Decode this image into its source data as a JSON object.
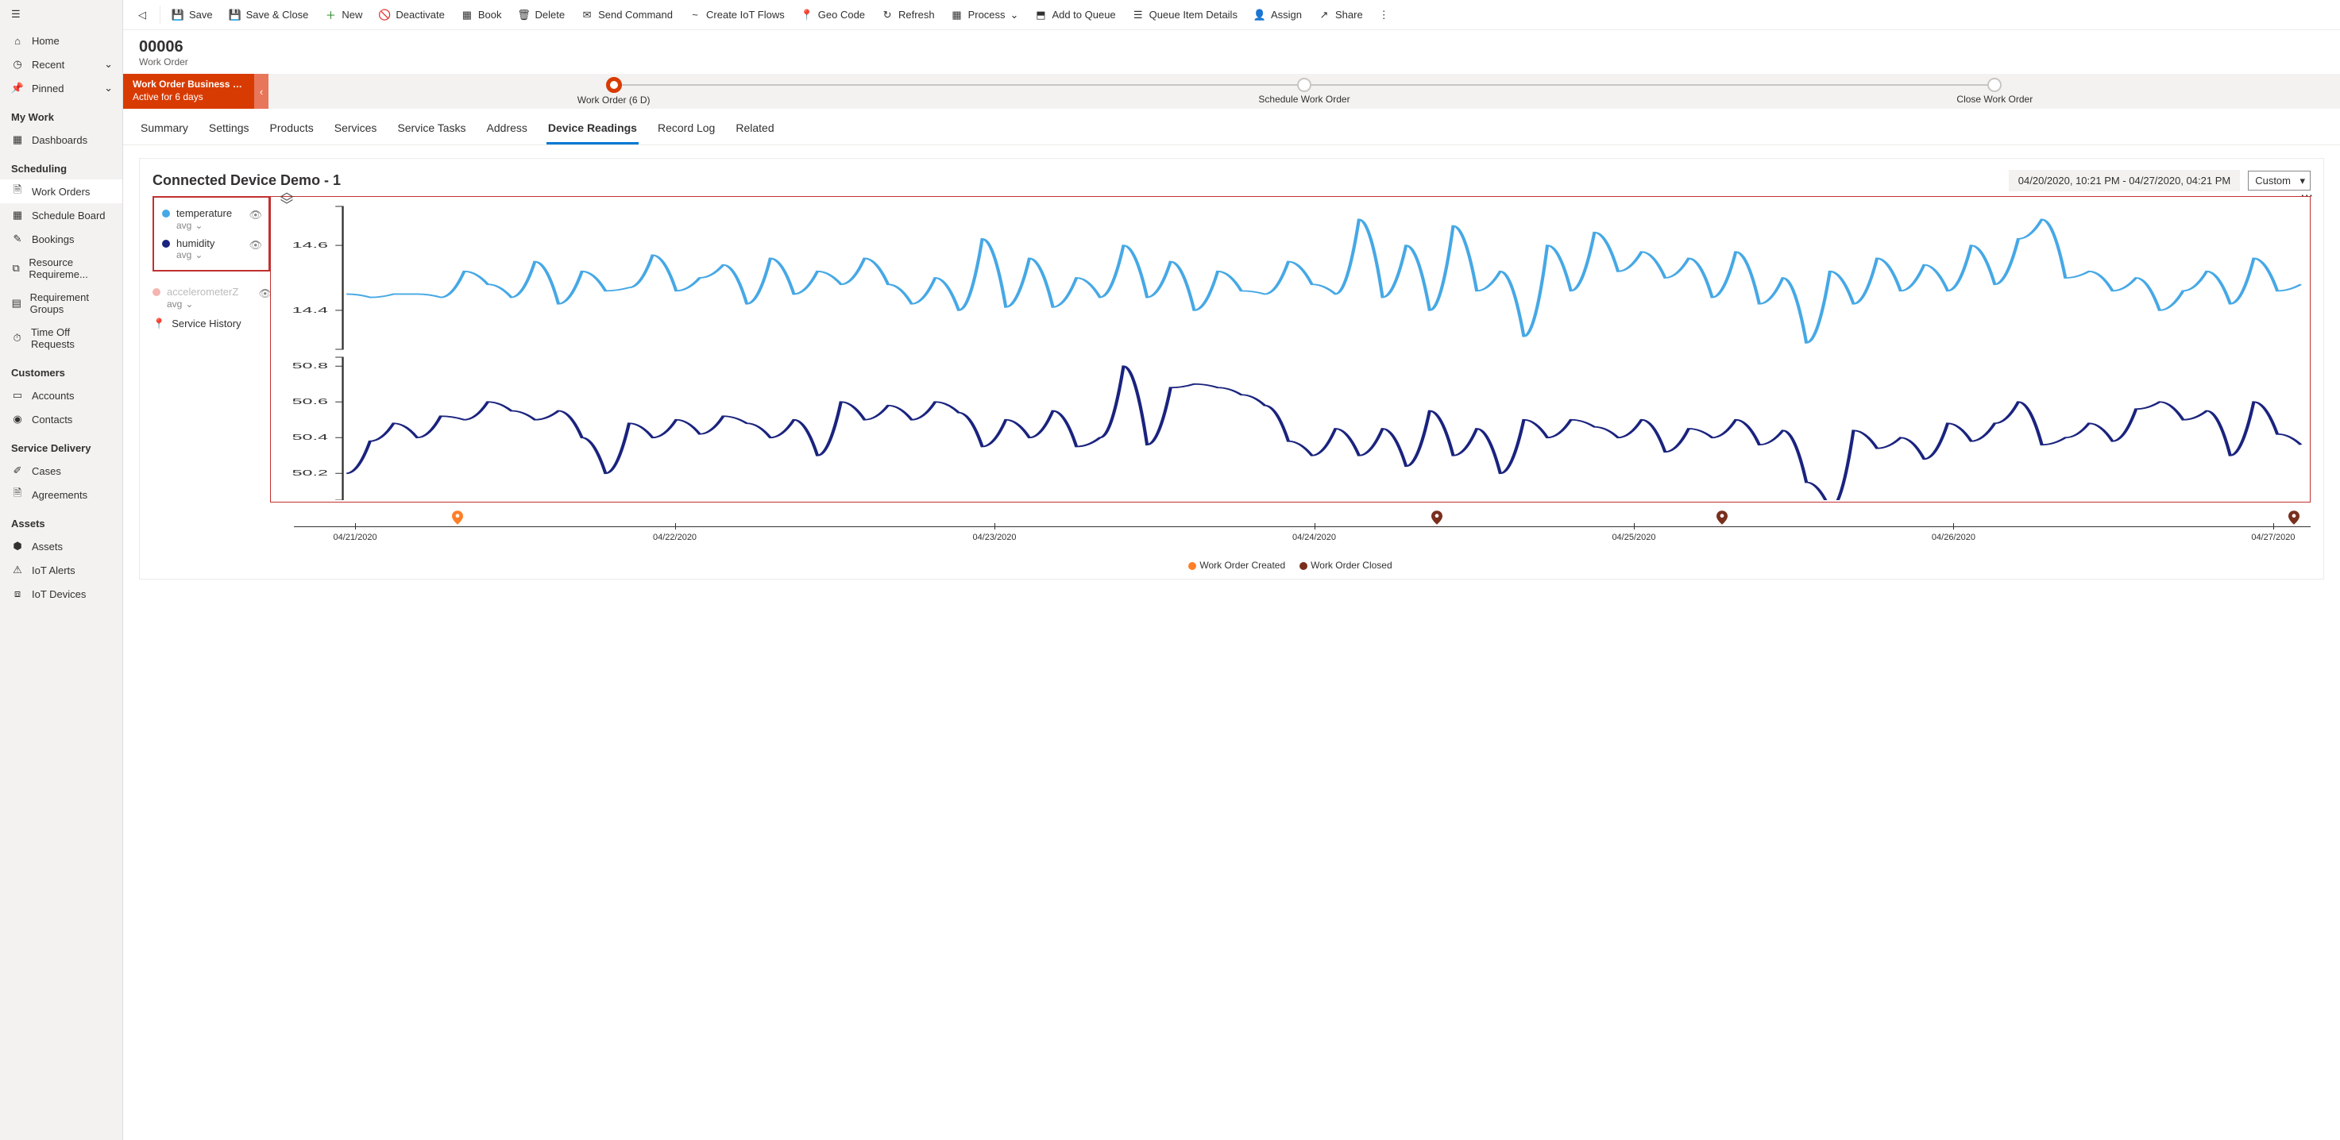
{
  "sidebar": {
    "top": [
      {
        "label": "Home",
        "icon": "home"
      },
      {
        "label": "Recent",
        "icon": "clock",
        "chev": true
      },
      {
        "label": "Pinned",
        "icon": "pin",
        "chev": true
      }
    ],
    "sections": [
      {
        "title": "My Work",
        "items": [
          {
            "label": "Dashboards",
            "icon": "dash"
          }
        ]
      },
      {
        "title": "Scheduling",
        "items": [
          {
            "label": "Work Orders",
            "icon": "doc",
            "selected": true
          },
          {
            "label": "Schedule Board",
            "icon": "cal"
          },
          {
            "label": "Bookings",
            "icon": "book"
          },
          {
            "label": "Resource Requireme...",
            "icon": "res"
          },
          {
            "label": "Requirement Groups",
            "icon": "group"
          },
          {
            "label": "Time Off Requests",
            "icon": "time"
          }
        ]
      },
      {
        "title": "Customers",
        "items": [
          {
            "label": "Accounts",
            "icon": "acct"
          },
          {
            "label": "Contacts",
            "icon": "person"
          }
        ]
      },
      {
        "title": "Service Delivery",
        "items": [
          {
            "label": "Cases",
            "icon": "case"
          },
          {
            "label": "Agreements",
            "icon": "agree"
          }
        ]
      },
      {
        "title": "Assets",
        "items": [
          {
            "label": "Assets",
            "icon": "asset"
          },
          {
            "label": "IoT Alerts",
            "icon": "iotalert"
          },
          {
            "label": "IoT Devices",
            "icon": "iotdev"
          }
        ]
      }
    ]
  },
  "commands": [
    {
      "label": "Save",
      "icon": "save"
    },
    {
      "label": "Save & Close",
      "icon": "saveclose"
    },
    {
      "label": "New",
      "icon": "plus",
      "color": "#107c10"
    },
    {
      "label": "Deactivate",
      "icon": "deact"
    },
    {
      "label": "Book",
      "icon": "cal"
    },
    {
      "label": "Delete",
      "icon": "trash"
    },
    {
      "label": "Send Command",
      "icon": "send"
    },
    {
      "label": "Create IoT Flows",
      "icon": "flow"
    },
    {
      "label": "Geo Code",
      "icon": "geo"
    },
    {
      "label": "Refresh",
      "icon": "refresh"
    },
    {
      "label": "Process",
      "icon": "process",
      "caret": true
    },
    {
      "label": "Add to Queue",
      "icon": "queue"
    },
    {
      "label": "Queue Item Details",
      "icon": "qdetails"
    },
    {
      "label": "Assign",
      "icon": "assign"
    },
    {
      "label": "Share",
      "icon": "share"
    }
  ],
  "record": {
    "title": "00006",
    "subtitle": "Work Order"
  },
  "process": {
    "flag_line1": "Work Order Business Pro...",
    "flag_line2": "Active for 6 days",
    "stages": [
      {
        "label": "Work Order  (6 D)",
        "active": true
      },
      {
        "label": "Schedule Work Order"
      },
      {
        "label": "Close Work Order"
      }
    ]
  },
  "tabs": [
    "Summary",
    "Settings",
    "Products",
    "Services",
    "Service Tasks",
    "Address",
    "Device Readings",
    "Record Log",
    "Related"
  ],
  "active_tab": "Device Readings",
  "card": {
    "title": "Connected Device Demo - 1",
    "range": "04/20/2020, 10:21 PM - 04/27/2020, 04:21 PM",
    "mode": "Custom",
    "legend": [
      {
        "name": "temperature",
        "agg": "avg",
        "color": "#46a8e5"
      },
      {
        "name": "humidity",
        "agg": "avg",
        "color": "#1a237e"
      }
    ],
    "legend_muted": {
      "name": "accelerometerZ",
      "agg": "avg",
      "color": "#f5b5b0"
    },
    "service_history_label": "Service History"
  },
  "chart_data": {
    "type": "line",
    "x_start": "04/21/2020",
    "x_end": "04/27/2020",
    "x_ticks": [
      "04/21/2020",
      "04/22/2020",
      "04/23/2020",
      "04/24/2020",
      "04/25/2020",
      "04/26/2020",
      "04/27/2020"
    ],
    "series": [
      {
        "name": "temperature",
        "color": "#46a8e5",
        "y_ticks": [
          14.4,
          14.6
        ],
        "y_range": [
          14.28,
          14.72
        ],
        "values": [
          14.45,
          14.44,
          14.45,
          14.45,
          14.44,
          14.52,
          14.48,
          14.44,
          14.55,
          14.42,
          14.52,
          14.46,
          14.47,
          14.57,
          14.46,
          14.5,
          14.54,
          14.42,
          14.56,
          14.45,
          14.52,
          14.48,
          14.56,
          14.48,
          14.42,
          14.5,
          14.4,
          14.62,
          14.41,
          14.56,
          14.41,
          14.5,
          14.44,
          14.6,
          14.44,
          14.55,
          14.4,
          14.52,
          14.46,
          14.45,
          14.55,
          14.48,
          14.45,
          14.68,
          14.44,
          14.6,
          14.4,
          14.66,
          14.46,
          14.52,
          14.32,
          14.6,
          14.46,
          14.64,
          14.52,
          14.58,
          14.5,
          14.56,
          14.44,
          14.58,
          14.42,
          14.5,
          14.3,
          14.52,
          14.42,
          14.56,
          14.46,
          14.54,
          14.46,
          14.6,
          14.48,
          14.62,
          14.68,
          14.5,
          14.52,
          14.46,
          14.5,
          14.4,
          14.46,
          14.52,
          14.42,
          14.56,
          14.46,
          14.48
        ]
      },
      {
        "name": "humidity",
        "color": "#1a237e",
        "y_ticks": [
          50.2,
          50.4,
          50.6,
          50.8
        ],
        "y_range": [
          50.05,
          50.85
        ],
        "values": [
          50.2,
          50.38,
          50.48,
          50.4,
          50.52,
          50.5,
          50.6,
          50.55,
          50.5,
          50.55,
          50.4,
          50.2,
          50.48,
          50.4,
          50.5,
          50.42,
          50.52,
          50.48,
          50.4,
          50.5,
          50.3,
          50.6,
          50.5,
          50.58,
          50.5,
          50.6,
          50.54,
          50.35,
          50.5,
          50.4,
          50.55,
          50.35,
          50.4,
          50.8,
          50.36,
          50.68,
          50.7,
          50.68,
          50.64,
          50.58,
          50.38,
          50.3,
          50.45,
          50.3,
          50.45,
          50.24,
          50.55,
          50.3,
          50.45,
          50.2,
          50.5,
          50.4,
          50.5,
          50.46,
          50.4,
          50.5,
          50.32,
          50.45,
          50.4,
          50.5,
          50.36,
          50.44,
          50.15,
          50.0,
          50.44,
          50.34,
          50.4,
          50.28,
          50.48,
          50.38,
          50.48,
          50.6,
          50.36,
          50.4,
          50.48,
          50.38,
          50.56,
          50.6,
          50.5,
          50.55,
          50.3,
          50.6,
          50.42,
          50.36
        ]
      }
    ],
    "events": [
      {
        "type": "created",
        "x_hint_pct": 8
      },
      {
        "type": "closed",
        "x_hint_pct": 56
      },
      {
        "type": "closed",
        "x_hint_pct": 70
      },
      {
        "type": "closed",
        "x_hint_pct": 98
      }
    ]
  },
  "footer_legend": [
    {
      "label": "Work Order Created",
      "color": "#ff7f27"
    },
    {
      "label": "Work Order Closed",
      "color": "#7a2f1d"
    }
  ]
}
